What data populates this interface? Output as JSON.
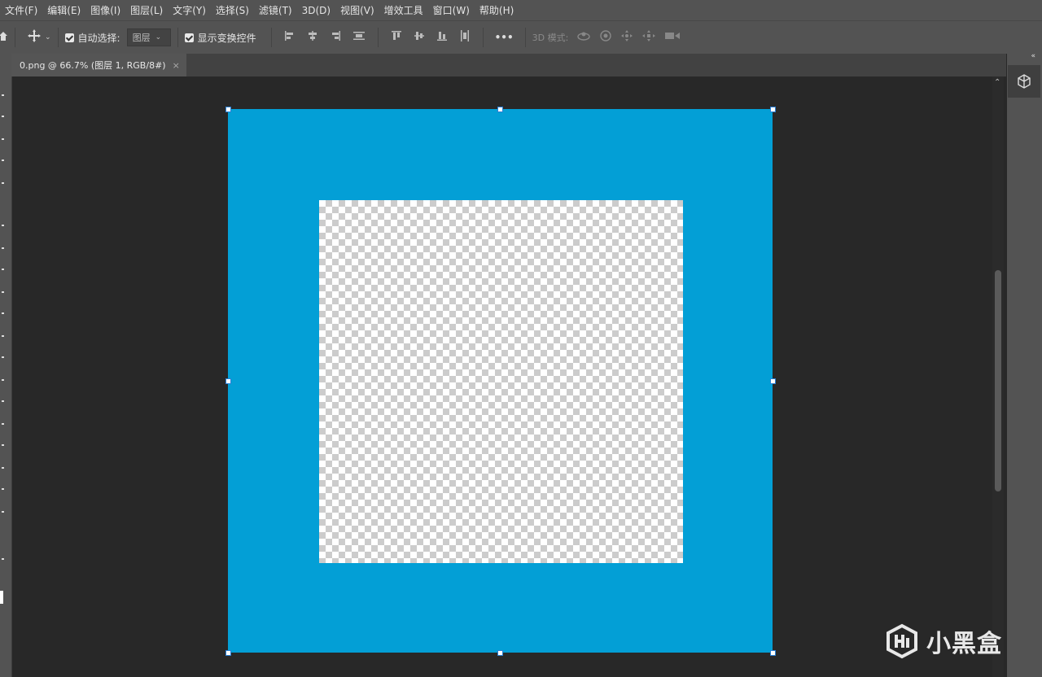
{
  "menu": [
    "文件(F)",
    "编辑(E)",
    "图像(I)",
    "图层(L)",
    "文字(Y)",
    "选择(S)",
    "滤镜(T)",
    "3D(D)",
    "视图(V)",
    "增效工具",
    "窗口(W)",
    "帮助(H)"
  ],
  "options": {
    "auto_select_label": "自动选择:",
    "auto_select_value": "图层",
    "show_transform_label": "显示变换控件",
    "more_label": "•••",
    "mode3d_label": "3D 模式:"
  },
  "document_tab": {
    "title": "0.png @ 66.7% (图层 1, RGB/8#)",
    "close": "×"
  },
  "canvas": {
    "frame_color": "#039fd6"
  },
  "watermark": {
    "text": "小黑盒"
  }
}
